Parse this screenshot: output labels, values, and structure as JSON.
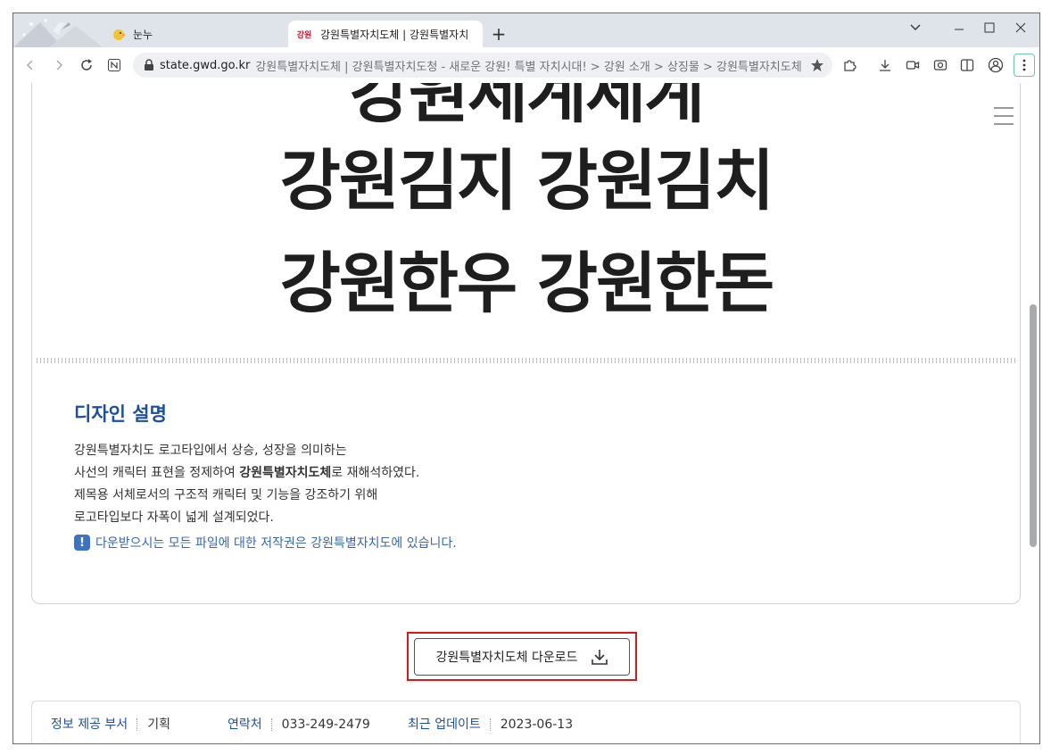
{
  "browser": {
    "tabs": [
      {
        "title": "눈누",
        "active": false
      },
      {
        "title": "강원특별자치도체 | 강원특별자치",
        "active": true
      }
    ],
    "favicon_text": "강원",
    "address": {
      "domain": "state.gwd.go.kr",
      "rest": "강원특별자치도체 | 강원특별자치도청 - 새로운 강원! 특별 자치시대! > 강원 소개 > 상징물 > 강원특별자치도체"
    }
  },
  "hero": {
    "lines": [
      "강원김지 강원김치",
      "강원한우 강원한돈"
    ],
    "partial_line": "강원세계세계"
  },
  "design": {
    "heading": "디자인 설명",
    "lines": [
      {
        "before": "강원특별자치도 로고타입에서 상승, 성장을 의미하는",
        "bold": "",
        "after": ""
      },
      {
        "before": "사선의 캐릭터 표현을 정제하여 ",
        "bold": "강원특별자치도체",
        "after": "로 재해석하였다."
      },
      {
        "before": "제목용 서체로서의 구조적 캐릭터 및 기능을 강조하기 위해",
        "bold": "",
        "after": ""
      },
      {
        "before": "로고타입보다 자폭이 넓게 설계되었다.",
        "bold": "",
        "after": ""
      }
    ],
    "notice_icon": "!",
    "notice": "다운받으시는 모든 파일에 대한 저작권은 강원특별자치도에 있습니다."
  },
  "download": {
    "label": "강원특별자치도체 다운로드"
  },
  "info": {
    "dept_label": "정보 제공 부서",
    "dept_value": "기획",
    "contact_label": "연락처",
    "contact_value": "033-249-2479",
    "updated_label": "최근 업데이트",
    "updated_value": "2023-06-13"
  },
  "colors": {
    "accent": "#1d4f9a",
    "highlight": "#d41a1f"
  }
}
